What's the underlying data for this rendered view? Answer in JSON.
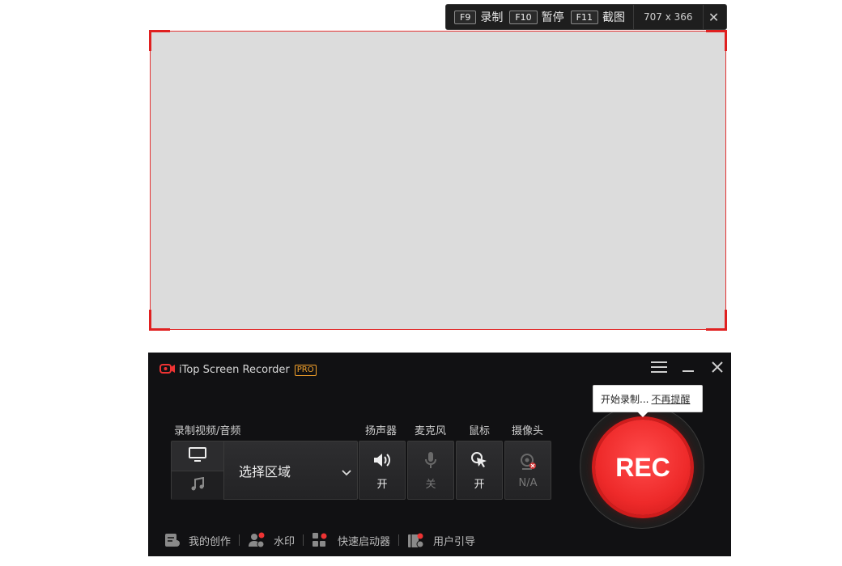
{
  "hotkeys": [
    {
      "key": "F9",
      "label": "录制"
    },
    {
      "key": "F10",
      "label": "暂停"
    },
    {
      "key": "F11",
      "label": "截图"
    }
  ],
  "capture": {
    "dimensions": "707 x 366"
  },
  "app": {
    "title": "iTop Screen Recorder",
    "badge": "PRO"
  },
  "sections": {
    "record": "录制视频/音频",
    "speaker": "扬声器",
    "mic": "麦克风",
    "mouse": "鼠标",
    "camera": "摄像头"
  },
  "mode": {
    "area_label": "选择区域"
  },
  "toggles": {
    "speaker": "开",
    "mic": "关",
    "mouse": "开",
    "camera": "N/A"
  },
  "rec": {
    "label": "REC"
  },
  "tooltip": {
    "text": "开始录制...",
    "link": "不再提醒"
  },
  "footer": [
    {
      "label": "我的创作"
    },
    {
      "label": "水印"
    },
    {
      "label": "快速启动器"
    },
    {
      "label": "用户引导"
    }
  ],
  "colors": {
    "accent": "#ee2a2a",
    "pro_badge": "#f3a12a",
    "panel_bg": "#111113"
  }
}
